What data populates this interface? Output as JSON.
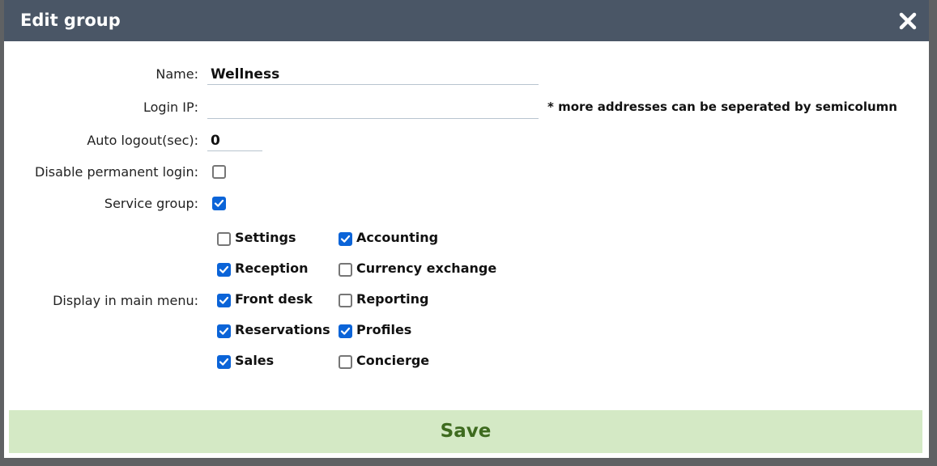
{
  "dialog": {
    "title": "Edit group",
    "close_icon": "close-icon"
  },
  "form": {
    "name": {
      "label": "Name:",
      "value": "Wellness"
    },
    "login_ip": {
      "label": "Login IP:",
      "value": "",
      "hint": "* more addresses can be seperated by semicolumn"
    },
    "auto_logout": {
      "label": "Auto logout(sec):",
      "value": "0"
    },
    "disable_permanent_login": {
      "label": "Disable permanent login:",
      "checked": false
    },
    "service_group": {
      "label": "Service group:",
      "checked": true
    },
    "main_menu": {
      "label": "Display in main menu:",
      "options": [
        {
          "label": "Settings",
          "checked": false
        },
        {
          "label": "Accounting",
          "checked": true
        },
        {
          "label": "Reception",
          "checked": true
        },
        {
          "label": "Currency exchange",
          "checked": false
        },
        {
          "label": "Front desk",
          "checked": true
        },
        {
          "label": "Reporting",
          "checked": false
        },
        {
          "label": "Reservations",
          "checked": true
        },
        {
          "label": "Profiles",
          "checked": true
        },
        {
          "label": "Sales",
          "checked": true
        },
        {
          "label": "Concierge",
          "checked": false
        }
      ]
    }
  },
  "actions": {
    "save_label": "Save"
  },
  "colors": {
    "titlebar": "#4a5666",
    "checkbox_checked": "#0b64d8",
    "save_bg": "#d4e9c5",
    "save_text": "#3e6b1f"
  }
}
